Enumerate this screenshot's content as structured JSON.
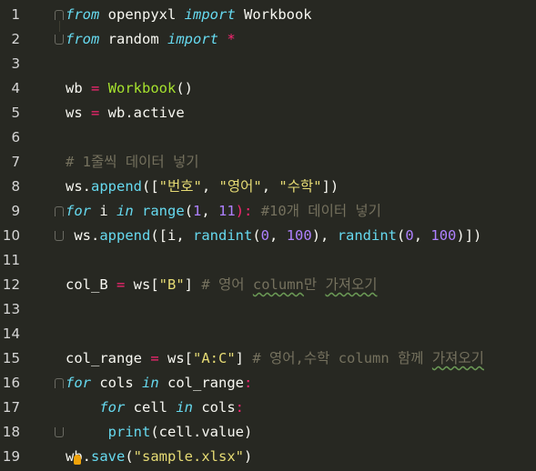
{
  "editor": {
    "language": "python",
    "lines": [
      {
        "num": "1",
        "tokens": [
          {
            "t": "from",
            "c": "k"
          },
          {
            "t": " openpyxl ",
            "c": "p"
          },
          {
            "t": "import",
            "c": "k"
          },
          {
            "t": " Workbook",
            "c": "p"
          }
        ]
      },
      {
        "num": "2",
        "tokens": [
          {
            "t": "from",
            "c": "k"
          },
          {
            "t": " random ",
            "c": "p"
          },
          {
            "t": "import",
            "c": "k"
          },
          {
            "t": " *",
            "c": "op"
          }
        ]
      },
      {
        "num": "3",
        "tokens": []
      },
      {
        "num": "4",
        "tokens": [
          {
            "t": "wb ",
            "c": "p"
          },
          {
            "t": "=",
            "c": "op"
          },
          {
            "t": " ",
            "c": "p"
          },
          {
            "t": "Workbook",
            "c": "cls"
          },
          {
            "t": "()",
            "c": "p"
          }
        ]
      },
      {
        "num": "5",
        "tokens": [
          {
            "t": "ws ",
            "c": "p"
          },
          {
            "t": "=",
            "c": "op"
          },
          {
            "t": " wb.active",
            "c": "p"
          }
        ]
      },
      {
        "num": "6",
        "tokens": []
      },
      {
        "num": "7",
        "tokens": [
          {
            "t": "# 1줄씩 데이터 넣기",
            "c": "c"
          }
        ]
      },
      {
        "num": "8",
        "tokens": [
          {
            "t": "ws.",
            "c": "p"
          },
          {
            "t": "append",
            "c": "fn"
          },
          {
            "t": "([",
            "c": "p"
          },
          {
            "t": "\"번호\"",
            "c": "s"
          },
          {
            "t": ", ",
            "c": "p"
          },
          {
            "t": "\"영어\"",
            "c": "s"
          },
          {
            "t": ", ",
            "c": "p"
          },
          {
            "t": "\"수학\"",
            "c": "s"
          },
          {
            "t": "])",
            "c": "p"
          }
        ]
      },
      {
        "num": "9",
        "tokens": [
          {
            "t": "for",
            "c": "k"
          },
          {
            "t": " i ",
            "c": "p"
          },
          {
            "t": "in",
            "c": "k"
          },
          {
            "t": " ",
            "c": "p"
          },
          {
            "t": "range",
            "c": "fn"
          },
          {
            "t": "(",
            "c": "p"
          },
          {
            "t": "1",
            "c": "n"
          },
          {
            "t": ", ",
            "c": "p"
          },
          {
            "t": "11",
            "c": "n"
          },
          {
            "t": "):",
            "c": "op"
          },
          {
            "t": " #10개 데이터 넣기",
            "c": "c"
          }
        ]
      },
      {
        "num": "10",
        "tokens": [
          {
            "t": " ws.",
            "c": "p"
          },
          {
            "t": "append",
            "c": "fn"
          },
          {
            "t": "([i, ",
            "c": "p"
          },
          {
            "t": "randint",
            "c": "fn"
          },
          {
            "t": "(",
            "c": "p"
          },
          {
            "t": "0",
            "c": "n"
          },
          {
            "t": ", ",
            "c": "p"
          },
          {
            "t": "100",
            "c": "n"
          },
          {
            "t": "), ",
            "c": "p"
          },
          {
            "t": "randint",
            "c": "fn"
          },
          {
            "t": "(",
            "c": "p"
          },
          {
            "t": "0",
            "c": "n"
          },
          {
            "t": ", ",
            "c": "p"
          },
          {
            "t": "100",
            "c": "n"
          },
          {
            "t": ")])",
            "c": "p"
          }
        ]
      },
      {
        "num": "11",
        "tokens": []
      },
      {
        "num": "12",
        "tokens": [
          {
            "t": "col_B ",
            "c": "p"
          },
          {
            "t": "=",
            "c": "op"
          },
          {
            "t": " ws[",
            "c": "p"
          },
          {
            "t": "\"B\"",
            "c": "s"
          },
          {
            "t": "]",
            "c": "p"
          },
          {
            "t": " # 영어 ",
            "c": "c"
          },
          {
            "t": "column",
            "c": "cu"
          },
          {
            "t": "만 ",
            "c": "c"
          },
          {
            "t": "가져오기",
            "c": "cu"
          }
        ]
      },
      {
        "num": "13",
        "tokens": []
      },
      {
        "num": "14",
        "tokens": []
      },
      {
        "num": "15",
        "tokens": [
          {
            "t": "col_range ",
            "c": "p"
          },
          {
            "t": "=",
            "c": "op"
          },
          {
            "t": " ws[",
            "c": "p"
          },
          {
            "t": "\"A:C\"",
            "c": "s"
          },
          {
            "t": "]",
            "c": "p"
          },
          {
            "t": " # 영어,수학 column 함께 ",
            "c": "c"
          },
          {
            "t": "가져오기",
            "c": "cu"
          }
        ]
      },
      {
        "num": "16",
        "tokens": [
          {
            "t": "for",
            "c": "k"
          },
          {
            "t": " cols ",
            "c": "p"
          },
          {
            "t": "in",
            "c": "k"
          },
          {
            "t": " col_range",
            "c": "p"
          },
          {
            "t": ":",
            "c": "op"
          }
        ]
      },
      {
        "num": "17",
        "tokens": [
          {
            "t": "    ",
            "c": "p"
          },
          {
            "t": "for",
            "c": "k"
          },
          {
            "t": " cell ",
            "c": "p"
          },
          {
            "t": "in",
            "c": "k"
          },
          {
            "t": " cols",
            "c": "p"
          },
          {
            "t": ":",
            "c": "op"
          }
        ]
      },
      {
        "num": "18",
        "tokens": [
          {
            "t": "     ",
            "c": "p"
          },
          {
            "t": "print",
            "c": "fn"
          },
          {
            "t": "(cell.value)",
            "c": "p"
          }
        ]
      },
      {
        "num": "19",
        "tokens": [
          {
            "t": "wb.",
            "c": "p"
          },
          {
            "t": "save",
            "c": "fn"
          },
          {
            "t": "(",
            "c": "p"
          },
          {
            "t": "\"sample.xlsx\"",
            "c": "s"
          },
          {
            "t": ")",
            "c": "p"
          }
        ]
      }
    ],
    "fold_markers": [
      {
        "line": 1,
        "kind": "open"
      },
      {
        "line": 2,
        "kind": "close"
      },
      {
        "line": 9,
        "kind": "open"
      },
      {
        "line": 10,
        "kind": "close"
      },
      {
        "line": 16,
        "kind": "open"
      },
      {
        "line": 18,
        "kind": "close"
      }
    ],
    "colors": {
      "background": "#272822",
      "keyword": "#66d9ef",
      "operator": "#f92672",
      "class": "#a6e22e",
      "number": "#ae81ff",
      "string": "#e6db74",
      "comment": "#75715e",
      "plain": "#f8f8f2"
    },
    "hint_icon": "lightbulb-icon"
  }
}
